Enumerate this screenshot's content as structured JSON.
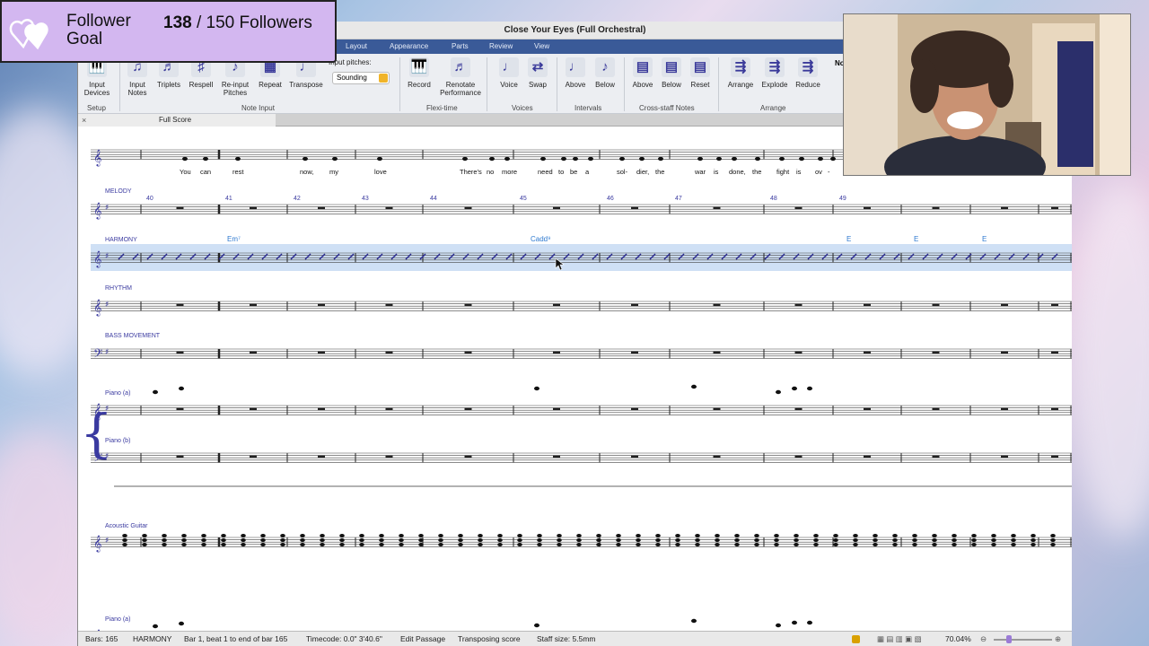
{
  "follower_goal": {
    "label_line1": "Follower",
    "label_line2": "Goal",
    "current": "138",
    "separator": "/",
    "target": "150 Followers",
    "progress": 0.92
  },
  "window": {
    "title": "Close Your Eyes (Full Orchestral)"
  },
  "tabs": [
    "Layout",
    "Appearance",
    "Parts",
    "Review",
    "View"
  ],
  "ribbon": {
    "buttons": [
      {
        "label": "Input\nDevices",
        "icon": "piano-keyboard-icon"
      },
      {
        "label": "Input\nNotes",
        "icon": "note-input-icon"
      },
      {
        "label": "Triplets",
        "icon": "triplets-icon"
      },
      {
        "label": "Respell",
        "icon": "respell-icon"
      },
      {
        "label": "Re-input\nPitches",
        "icon": "reinput-icon"
      },
      {
        "label": "Repeat",
        "icon": "repeat-icon"
      },
      {
        "label": "Transpose",
        "icon": "transpose-icon"
      },
      {
        "label": "Record",
        "icon": "record-icon"
      },
      {
        "label": "Renotate\nPerformance",
        "icon": "renotate-icon"
      },
      {
        "label": "Voice",
        "icon": "voice-icon"
      },
      {
        "label": "Swap",
        "icon": "swap-icon"
      },
      {
        "label": "Above",
        "icon": "above-icon"
      },
      {
        "label": "Below",
        "icon": "below-icon"
      },
      {
        "label": "Above",
        "icon": "staff-above-icon"
      },
      {
        "label": "Below",
        "icon": "staff-below-icon"
      },
      {
        "label": "Reset",
        "icon": "reset-icon"
      },
      {
        "label": "Arrange",
        "icon": "arrange-icon"
      },
      {
        "label": "Explode",
        "icon": "explode-icon"
      },
      {
        "label": "Reduce",
        "icon": "reduce-icon"
      }
    ],
    "input_pitches_label": "Input pitches:",
    "input_pitches_value": "Sounding",
    "groups": [
      "Setup",
      "Note Input",
      "Flexi-time",
      "Voices",
      "Intervals",
      "Cross-staff Notes",
      "Arrange"
    ],
    "cut_label": "No"
  },
  "score_tab": "Full Score",
  "lyrics": [
    "You",
    "can",
    "rest",
    "now,",
    "my",
    "love",
    "There's",
    "no",
    "more",
    "need",
    "to",
    "be",
    "a",
    "sol-",
    "dier,",
    "the",
    "war",
    "is",
    "done,",
    "the",
    "fight",
    "is",
    "ov",
    "-"
  ],
  "bar_numbers": [
    "40",
    "41",
    "42",
    "43",
    "44",
    "45",
    "46",
    "47",
    "48",
    "49"
  ],
  "staves": {
    "melody": "MELODY",
    "harmony": "HARMONY",
    "rhythm": "RHYTHM",
    "bass": "BASS MOVEMENT",
    "piano_a": "Piano (a)",
    "piano_b": "Piano (b)",
    "guitar": "Acoustic Guitar",
    "piano_a2": "Piano (a)"
  },
  "chords": [
    "Em⁷",
    "Cadd⁹",
    "E",
    "E",
    "E"
  ],
  "status": {
    "bars": "Bars: 165",
    "instrument": "HARMONY",
    "selection": "Bar 1, beat 1 to end of bar 165",
    "timecode": "Timecode: 0.0\" 3'40.6\"",
    "edit": "Edit Passage",
    "transposing": "Transposing score",
    "staff_size": "Staff size: 5.5mm",
    "zoom": "70.04%"
  }
}
